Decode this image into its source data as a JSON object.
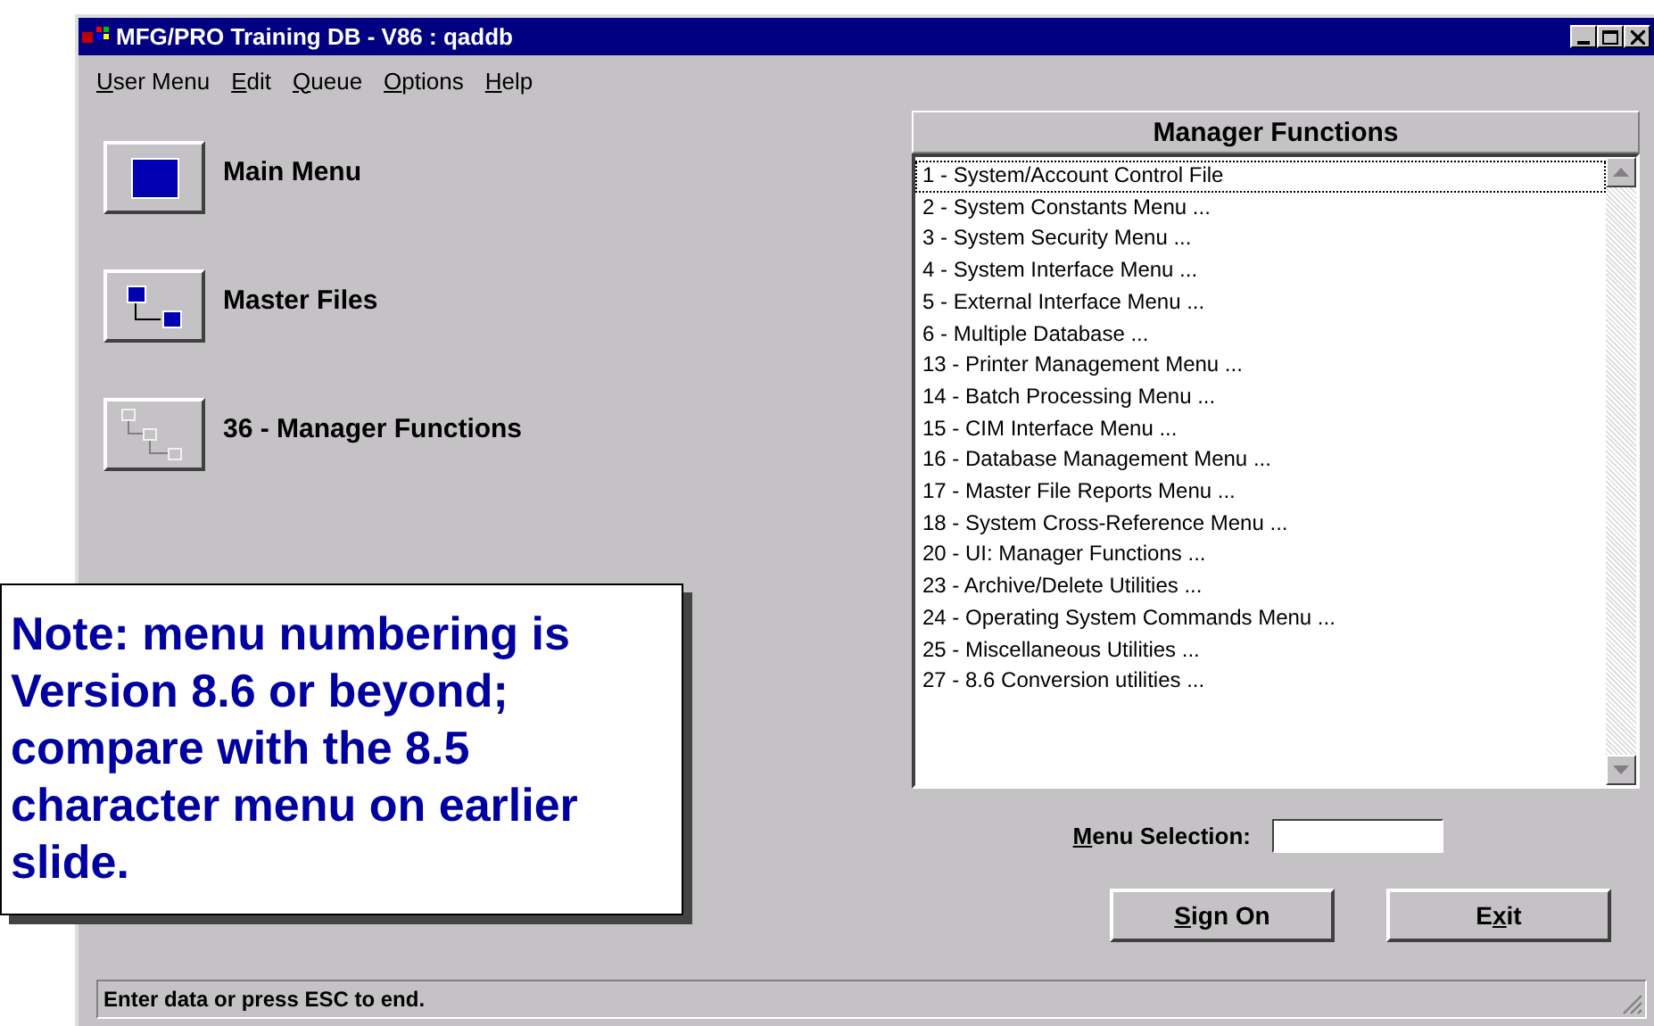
{
  "window": {
    "title": "MFG/PRO Training DB - V86 : qaddb"
  },
  "menu_bar": [
    {
      "key": "U",
      "after": "ser Menu"
    },
    {
      "key": "E",
      "after": "dit"
    },
    {
      "key": "Q",
      "after": "ueue"
    },
    {
      "key": "O",
      "after": "ptions"
    },
    {
      "key": "H",
      "after": "elp"
    }
  ],
  "path_buttons": [
    {
      "kind": "single",
      "label": "Main Menu",
      "disabled": false
    },
    {
      "kind": "tree2",
      "label": "Master Files",
      "disabled": false
    },
    {
      "kind": "tree3",
      "label": "36 - Manager Functions",
      "disabled": true
    }
  ],
  "panel": {
    "title": "Manager Functions",
    "items": [
      {
        "label": "1 - System/Account Control File",
        "focused": true
      },
      {
        "label": "2 - System Constants Menu ...",
        "focused": false
      },
      {
        "label": "3 - System Security Menu ...",
        "focused": false
      },
      {
        "label": "4 - System Interface Menu ...",
        "focused": false
      },
      {
        "label": "5 - External Interface Menu ...",
        "focused": false
      },
      {
        "label": "6 - Multiple Database ...",
        "focused": false
      },
      {
        "label": "13 - Printer Management Menu ...",
        "focused": false
      },
      {
        "label": "14 - Batch Processing Menu ...",
        "focused": false
      },
      {
        "label": "15 - CIM Interface Menu ...",
        "focused": false
      },
      {
        "label": "16 - Database Management Menu ...",
        "focused": false
      },
      {
        "label": "17 - Master File Reports Menu ...",
        "focused": false
      },
      {
        "label": "18 - System Cross-Reference Menu ...",
        "focused": false
      },
      {
        "label": "20 - UI: Manager Functions ...",
        "focused": false
      },
      {
        "label": "23 - Archive/Delete Utilities ...",
        "focused": false
      },
      {
        "label": "24 - Operating System Commands Menu ...",
        "focused": false
      },
      {
        "label": "25 - Miscellaneous Utilities ...",
        "focused": false
      },
      {
        "label": "27 - 8.6 Conversion utilities ...",
        "focused": false
      }
    ]
  },
  "menu_selection": {
    "label": {
      "key": "M",
      "after": "enu Selection:"
    }
  },
  "buttons": [
    {
      "key": "S",
      "after": "ign On"
    },
    {
      "before": "E",
      "key": "x",
      "after": "it"
    }
  ],
  "status_bar": "Enter data or press ESC to end.",
  "note": "Note: menu numbering is Version 8.6 or beyond; compare with the 8.5 character menu on earlier slide."
}
